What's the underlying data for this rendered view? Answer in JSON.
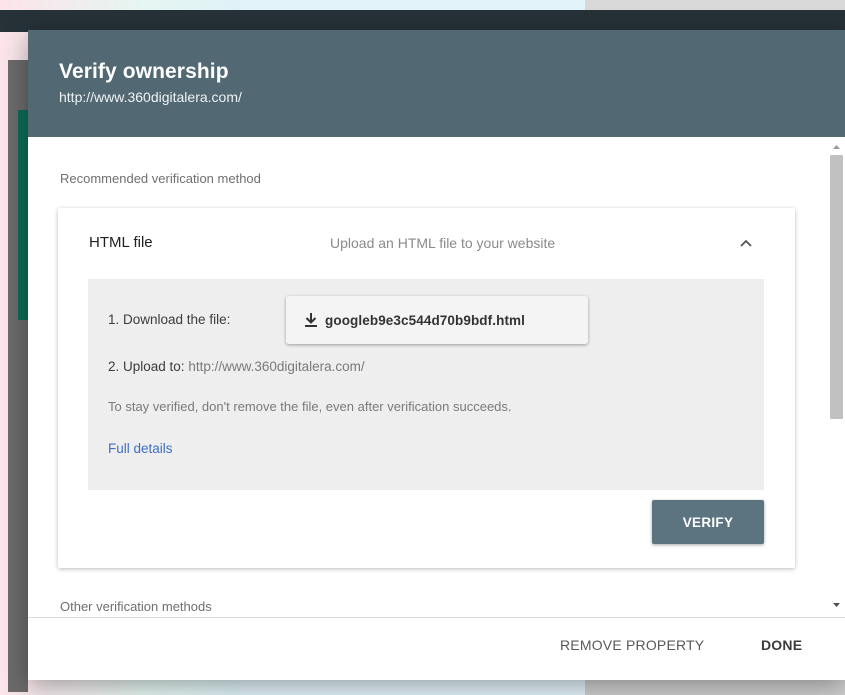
{
  "dialog": {
    "title": "Verify ownership",
    "subtitle": "http://www.360digitalera.com/",
    "header_color": "#526872"
  },
  "body": {
    "recommended_label": "Recommended verification method",
    "other_label": "Other verification methods"
  },
  "card": {
    "title": "HTML file",
    "description": "Upload an HTML file to your website",
    "chevron_icon": "chevron-up-icon",
    "steps": {
      "step1_label": "1. Download the file:",
      "download_icon": "download-icon",
      "file_name": "googleb9e3c544d70b9bdf.html",
      "step2_label": "2. Upload to:",
      "step2_url": "http://www.360digitalera.com/",
      "note": "To stay verified, don't remove the file, even after verification succeeds.",
      "details_link": "Full details"
    },
    "verify_label": "VERIFY",
    "verify_color": "#5b7480"
  },
  "footer": {
    "remove_label": "REMOVE PROPERTY",
    "done_label": "DONE"
  },
  "colors": {
    "link": "#3e6fc1",
    "inner_panel": "#eeeeee"
  }
}
